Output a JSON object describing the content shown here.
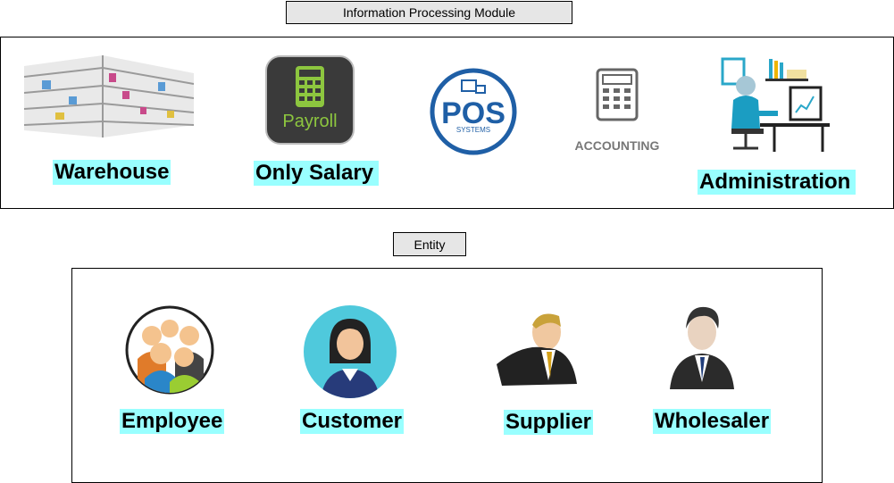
{
  "module": {
    "title": "Information Processing Module",
    "items": [
      {
        "label": "Warehouse",
        "icon": "warehouse-shelves-icon"
      },
      {
        "label": "Only Salary",
        "icon": "payroll-app-icon"
      },
      {
        "label": "",
        "icon": "pos-systems-icon"
      },
      {
        "label": "",
        "icon": "accounting-calculator-icon"
      },
      {
        "label": "Administration",
        "icon": "admin-desk-icon"
      }
    ],
    "payroll_text": "Payroll",
    "pos_text": "POS",
    "pos_sub": "SYSTEMS",
    "accounting_text": "ACCOUNTING"
  },
  "entity": {
    "title": "Entity",
    "items": [
      {
        "label": "Employee",
        "icon": "employee-group-icon"
      },
      {
        "label": "Customer",
        "icon": "customer-avatar-icon"
      },
      {
        "label": "Supplier",
        "icon": "supplier-businessman-icon"
      },
      {
        "label": "Wholesaler",
        "icon": "wholesaler-businessman-icon"
      }
    ]
  },
  "colors": {
    "label_bg": "#99ffff",
    "title_bg": "#e6e6e6",
    "pos_blue": "#1f5fa6",
    "payroll_green": "#8dc63f"
  }
}
